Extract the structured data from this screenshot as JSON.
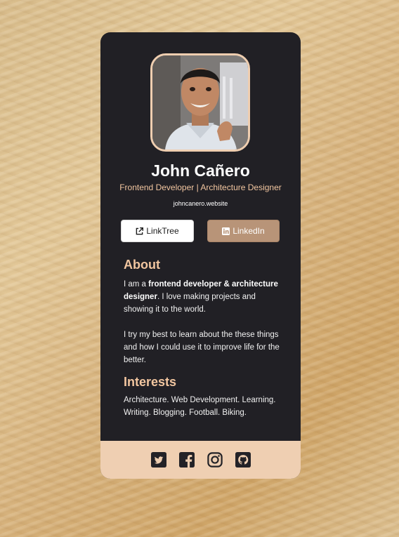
{
  "profile": {
    "name": "John Cañero",
    "role": "Frontend Developer | Architecture Designer",
    "website": "johncanero.website"
  },
  "buttons": {
    "linktree_label": "LinkTree",
    "linkedin_label": "LinkedIn",
    "linktree_icon": "external-link-icon",
    "linkedin_icon": "linkedin-icon"
  },
  "about": {
    "heading": "About",
    "p1_prefix": "I am a ",
    "p1_bold": "frontend developer & architecture designer",
    "p1_suffix": ". I love making projects and showing it to the world.",
    "p2": "I try my best to learn about the these things and how I could use it to improve life for the better."
  },
  "interests": {
    "heading": "Interests",
    "text": "Architecture. Web Development. Learning. Writing. Blogging. Football. Biking."
  },
  "footer": {
    "icons": [
      "twitter-icon",
      "facebook-icon",
      "instagram-icon",
      "github-icon"
    ]
  },
  "colors": {
    "card_bg": "#212025",
    "accent": "#f2c6a0",
    "footer_bg": "#efcfb2",
    "linkedin_button": "#b89478"
  }
}
